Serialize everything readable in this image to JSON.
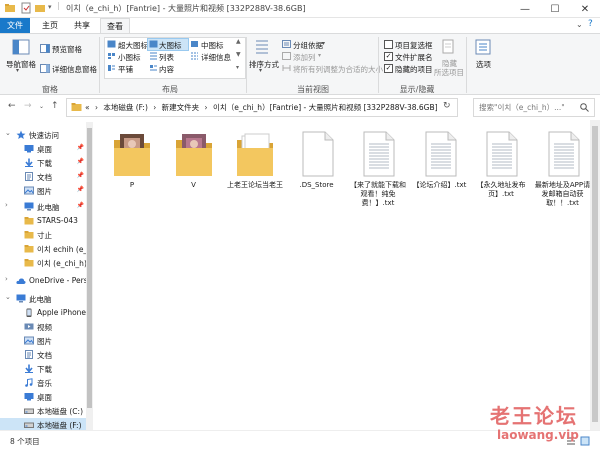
{
  "window": {
    "title": "이치（e_chi_h）[Fantrie] - 大量照片和视频 [332P288V-38.6GB]",
    "controls": [
      "—",
      "☐",
      "✕"
    ]
  },
  "ribbon_tabs": [
    "文件",
    "主页",
    "共享",
    "查看"
  ],
  "ribbon": {
    "panes": {
      "label": "窗格",
      "nav_pane": "导航窗格",
      "preview_pane": "预览窗格",
      "details_pane": "详细信息窗格"
    },
    "layout": {
      "label": "布局",
      "items": [
        "超大图标",
        "大图标",
        "中图标",
        "小图标",
        "列表",
        "详细信息",
        "平铺",
        "内容"
      ]
    },
    "current_view": {
      "label": "当前视图",
      "sort_by": "排序方式",
      "group_by": "分组依据",
      "add_columns": "添加列",
      "size_columns": "将所有列调整为合适的大小"
    },
    "show_hide": {
      "label": "显示/隐藏",
      "item_checkboxes": "项目复选框",
      "file_extensions": "文件扩展名",
      "hidden_items": "隐藏的项目",
      "hide_selected": [
        "隐藏",
        "所选项目"
      ],
      "options": "选项"
    }
  },
  "address": {
    "prefix": "«",
    "path": [
      "本地磁盘 (F:)",
      "新建文件夹",
      "이치（e_chi_h）[Fantrie] - 大量照片和视频 [332P288V-38.6GB]"
    ],
    "separator": "›",
    "search_placeholder": "搜索\"이치（e_chi_h）...\""
  },
  "nav": [
    {
      "label": "快速访问",
      "icon": "star-icon",
      "pinned": false
    },
    {
      "label": "桌面",
      "icon": "desktop-icon",
      "pinned": true
    },
    {
      "label": "下载",
      "icon": "download-icon",
      "pinned": true
    },
    {
      "label": "文档",
      "icon": "document-icon",
      "pinned": true
    },
    {
      "label": "图片",
      "icon": "pictures-icon",
      "pinned": true
    },
    {
      "label": "此电脑",
      "icon": "pc-icon",
      "pinned": true
    },
    {
      "label": "STARS-043",
      "icon": "folder-icon",
      "pinned": false
    },
    {
      "label": "寸止",
      "icon": "folder-icon",
      "pinned": false
    },
    {
      "label": "이치 echih (e_cl",
      "icon": "folder-icon",
      "pinned": false
    },
    {
      "label": "이치 (e_chi_h)",
      "icon": "folder-icon",
      "pinned": false
    },
    {
      "label": "OneDrive - Perso",
      "icon": "cloud-icon",
      "pinned": false
    },
    {
      "label": "此电脑",
      "icon": "pc-icon",
      "pinned": false
    },
    {
      "label": "Apple iPhone",
      "icon": "phone-icon",
      "pinned": false
    },
    {
      "label": "视频",
      "icon": "video-icon",
      "pinned": false
    },
    {
      "label": "图片",
      "icon": "pictures-icon",
      "pinned": false
    },
    {
      "label": "文档",
      "icon": "document-icon",
      "pinned": false
    },
    {
      "label": "下载",
      "icon": "download-icon",
      "pinned": false
    },
    {
      "label": "音乐",
      "icon": "music-icon",
      "pinned": false
    },
    {
      "label": "桌面",
      "icon": "desktop-icon",
      "pinned": false
    },
    {
      "label": "本地磁盘 (C:)",
      "icon": "drive-icon",
      "pinned": false
    },
    {
      "label": "本地磁盘 (F:)",
      "icon": "drive-icon",
      "pinned": false
    }
  ],
  "pin_glyph": "📌",
  "files": [
    {
      "name": "P",
      "type": "folder-photo"
    },
    {
      "name": "V",
      "type": "folder-photo"
    },
    {
      "name": "上老王论坛当老王",
      "type": "folder"
    },
    {
      "name": ".DS_Store",
      "type": "blank"
    },
    {
      "name": "【来了就能下载和观看！纯免费！】.txt",
      "type": "txt"
    },
    {
      "name": "【论坛介绍】.txt",
      "type": "txt"
    },
    {
      "name": "【永久地址发布页】.txt",
      "type": "txt"
    },
    {
      "name": "最新地址及APP请发邮箱自动获取！！.txt",
      "type": "txt"
    }
  ],
  "status": {
    "count": "8 个项目"
  },
  "watermark": {
    "line1": "老王论坛",
    "line2": "laowang.vip"
  }
}
